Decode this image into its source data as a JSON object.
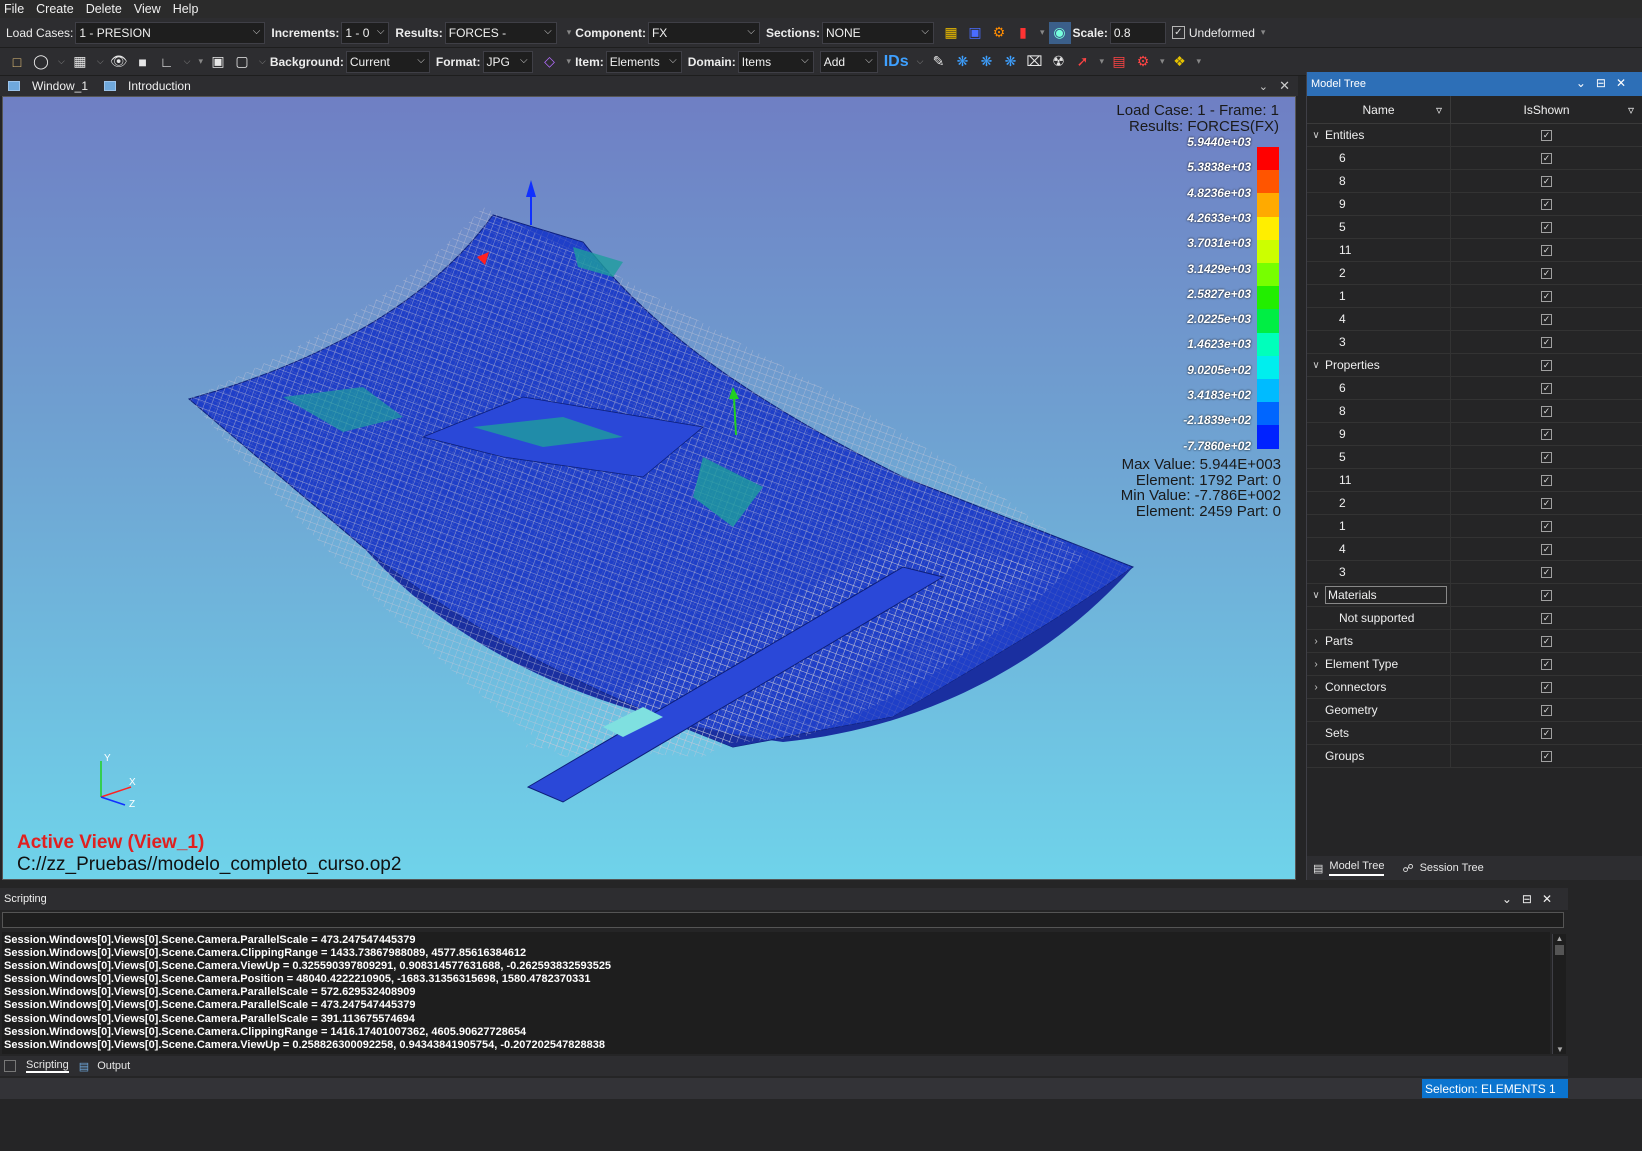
{
  "menu": [
    "File",
    "Create",
    "Delete",
    "View",
    "Help"
  ],
  "toolbar1": {
    "load_cases_label": "Load Cases:",
    "load_cases_value": "1 - PRESION",
    "increments_label": "Increments:",
    "increments_value": "1 - 0",
    "results_label": "Results:",
    "results_value": "FORCES -",
    "component_label": "Component:",
    "component_value": "FX",
    "sections_label": "Sections:",
    "sections_value": "NONE",
    "scale_label": "Scale:",
    "scale_value": "0.8",
    "undeformed_label": "Undeformed"
  },
  "toolbar2": {
    "background_label": "Background:",
    "background_value": "Current",
    "format_label": "Format:",
    "format_value": "JPG",
    "item_label": "Item:",
    "item_value": "Elements",
    "domain_label": "Domain:",
    "domain_value": "Items",
    "add_value": "Add",
    "ids_label": "IDs"
  },
  "doc_tabs": [
    "Window_1",
    "Introduction"
  ],
  "viewport": {
    "header_line1": "Load Case: 1 - Frame: 1",
    "header_line2": "Results: FORCES(FX)",
    "legend_values": [
      "5.9440e+03",
      "5.3838e+03",
      "4.8236e+03",
      "4.2633e+03",
      "3.7031e+03",
      "3.1429e+03",
      "2.5827e+03",
      "2.0225e+03",
      "1.4623e+03",
      "9.0205e+02",
      "3.4183e+02",
      "-2.1839e+02",
      "-7.7860e+02"
    ],
    "legend_colors": [
      "#ff0000",
      "#ff5500",
      "#ffaa00",
      "#ffee00",
      "#ccff00",
      "#77ff00",
      "#22ee00",
      "#00ee44",
      "#00ffbb",
      "#00eeee",
      "#00bbff",
      "#0066ff",
      "#0022ff"
    ],
    "max_value": "Max Value: 5.944E+003",
    "max_element": "Element: 1792 Part: 0",
    "min_value": "Min Value: -7.786E+002",
    "min_element": "Element: 2459 Part: 0",
    "active_view": "Active View (View_1)",
    "file_path": "C://zz_Pruebas//modelo_completo_curso.op2",
    "axis_y": "Y",
    "axis_x": "X",
    "axis_z": "Z"
  },
  "model_tree": {
    "title": "Model Tree",
    "col_name": "Name",
    "col_shown": "IsShown",
    "entities_label": "Entities",
    "entities": [
      "6",
      "8",
      "9",
      "5",
      "11",
      "2",
      "1",
      "4",
      "3"
    ],
    "properties_label": "Properties",
    "properties": [
      "6",
      "8",
      "9",
      "5",
      "11",
      "2",
      "1",
      "4",
      "3"
    ],
    "materials_label": "Materials",
    "not_supported": "Not supported",
    "parts": "Parts",
    "element_type": "Element Type",
    "connectors": "Connectors",
    "geometry": "Geometry",
    "sets": "Sets",
    "groups": "Groups",
    "tab_model_tree": "Model Tree",
    "tab_session_tree": "Session Tree"
  },
  "scripting": {
    "title": "Scripting",
    "lines": [
      "Session.Windows[0].Views[0].Scene.Camera.ParallelScale = 473.247547445379",
      "Session.Windows[0].Views[0].Scene.Camera.ClippingRange = 1433.73867988089, 4577.85616384612",
      "Session.Windows[0].Views[0].Scene.Camera.ViewUp = 0.325590397809291, 0.908314577631688, -0.262593832593525",
      "Session.Windows[0].Views[0].Scene.Camera.Position = 48040.4222210905, -1683.31356315698, 1580.4782370331",
      "Session.Windows[0].Views[0].Scene.Camera.ParallelScale = 572.629532408909",
      "Session.Windows[0].Views[0].Scene.Camera.ParallelScale = 473.247547445379",
      "Session.Windows[0].Views[0].Scene.Camera.ParallelScale = 391.113675574694",
      "Session.Windows[0].Views[0].Scene.Camera.ClippingRange = 1416.17401007362, 4605.90627728654",
      "Session.Windows[0].Views[0].Scene.Camera.ViewUp = 0.258826300092258, 0.94343841905754, -0.207202547828838"
    ],
    "tab_scripting": "Scripting",
    "tab_output": "Output"
  },
  "status": {
    "selection": "Selection:  ELEMENTS   1"
  }
}
